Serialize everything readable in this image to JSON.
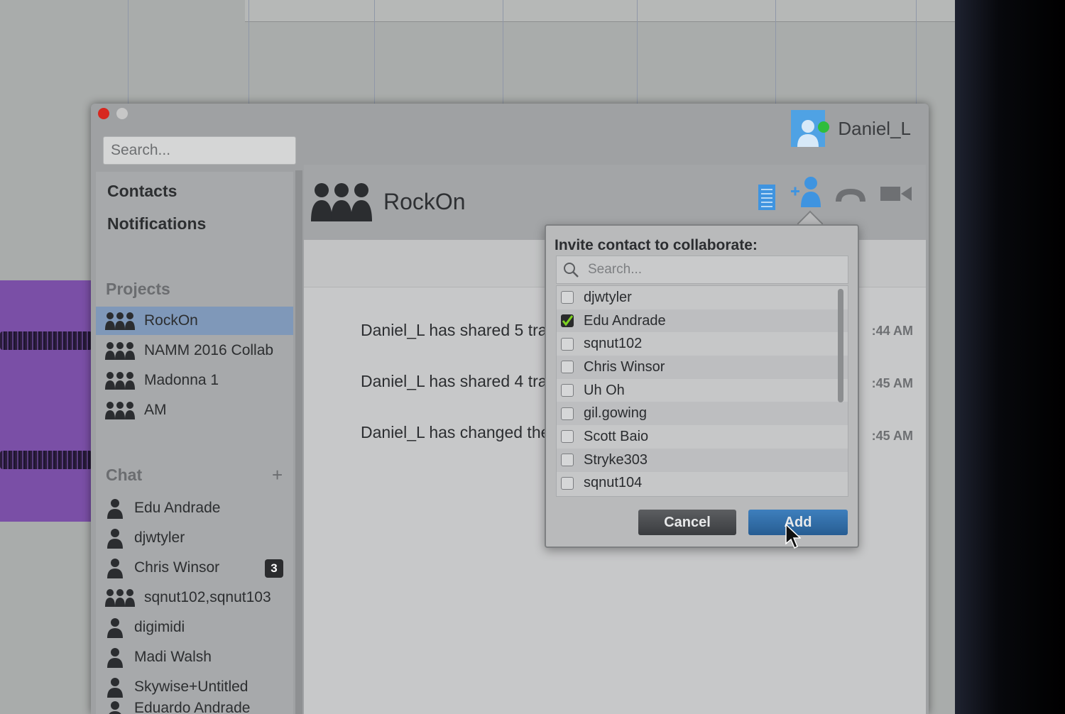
{
  "user": {
    "name": "Daniel_L"
  },
  "sidebar": {
    "search_placeholder": "Search...",
    "nav": [
      "Contacts",
      "Notifications"
    ],
    "projects_header": "Projects",
    "projects": [
      "RockOn",
      "NAMM 2016 Collab",
      "Madonna 1",
      "AM"
    ],
    "chat_header": "Chat",
    "chat_add": "+",
    "chats": [
      {
        "name": "Edu Andrade",
        "type": "single"
      },
      {
        "name": "djwtyler",
        "type": "single"
      },
      {
        "name": "Chris Winsor",
        "type": "single",
        "badge": "3"
      },
      {
        "name": "sqnut102,sqnut103",
        "type": "group"
      },
      {
        "name": "digimidi",
        "type": "single"
      },
      {
        "name": "Madi Walsh",
        "type": "single"
      },
      {
        "name": "Skywise+Untitled",
        "type": "single"
      },
      {
        "name": "Eduardo Andrade",
        "type": "single"
      }
    ]
  },
  "main": {
    "title": "RockOn",
    "messages": [
      {
        "text": "Daniel_L has shared 5 trac",
        "time": ":44 AM"
      },
      {
        "text": "Daniel_L has shared 4 trac",
        "time": ":45 AM"
      },
      {
        "text": "Daniel_L has changed the",
        "time": ":45 AM"
      }
    ]
  },
  "popover": {
    "title": "Invite contact to collaborate:",
    "search_placeholder": "Search...",
    "contacts": [
      {
        "name": "djwtyler",
        "checked": false
      },
      {
        "name": "Edu Andrade",
        "checked": true
      },
      {
        "name": "sqnut102",
        "checked": false
      },
      {
        "name": "Chris Winsor",
        "checked": false
      },
      {
        "name": "Uh Oh",
        "checked": false
      },
      {
        "name": "gil.gowing",
        "checked": false
      },
      {
        "name": "Scott Baio",
        "checked": false
      },
      {
        "name": "Stryke303",
        "checked": false
      },
      {
        "name": "sqnut104",
        "checked": false
      }
    ],
    "cancel_label": "Cancel",
    "add_label": "Add"
  },
  "colors": {
    "accent": "#4fa2e4",
    "selection": "#7f98b9",
    "presence": "#2fbd3c",
    "check": "#7ed321"
  }
}
